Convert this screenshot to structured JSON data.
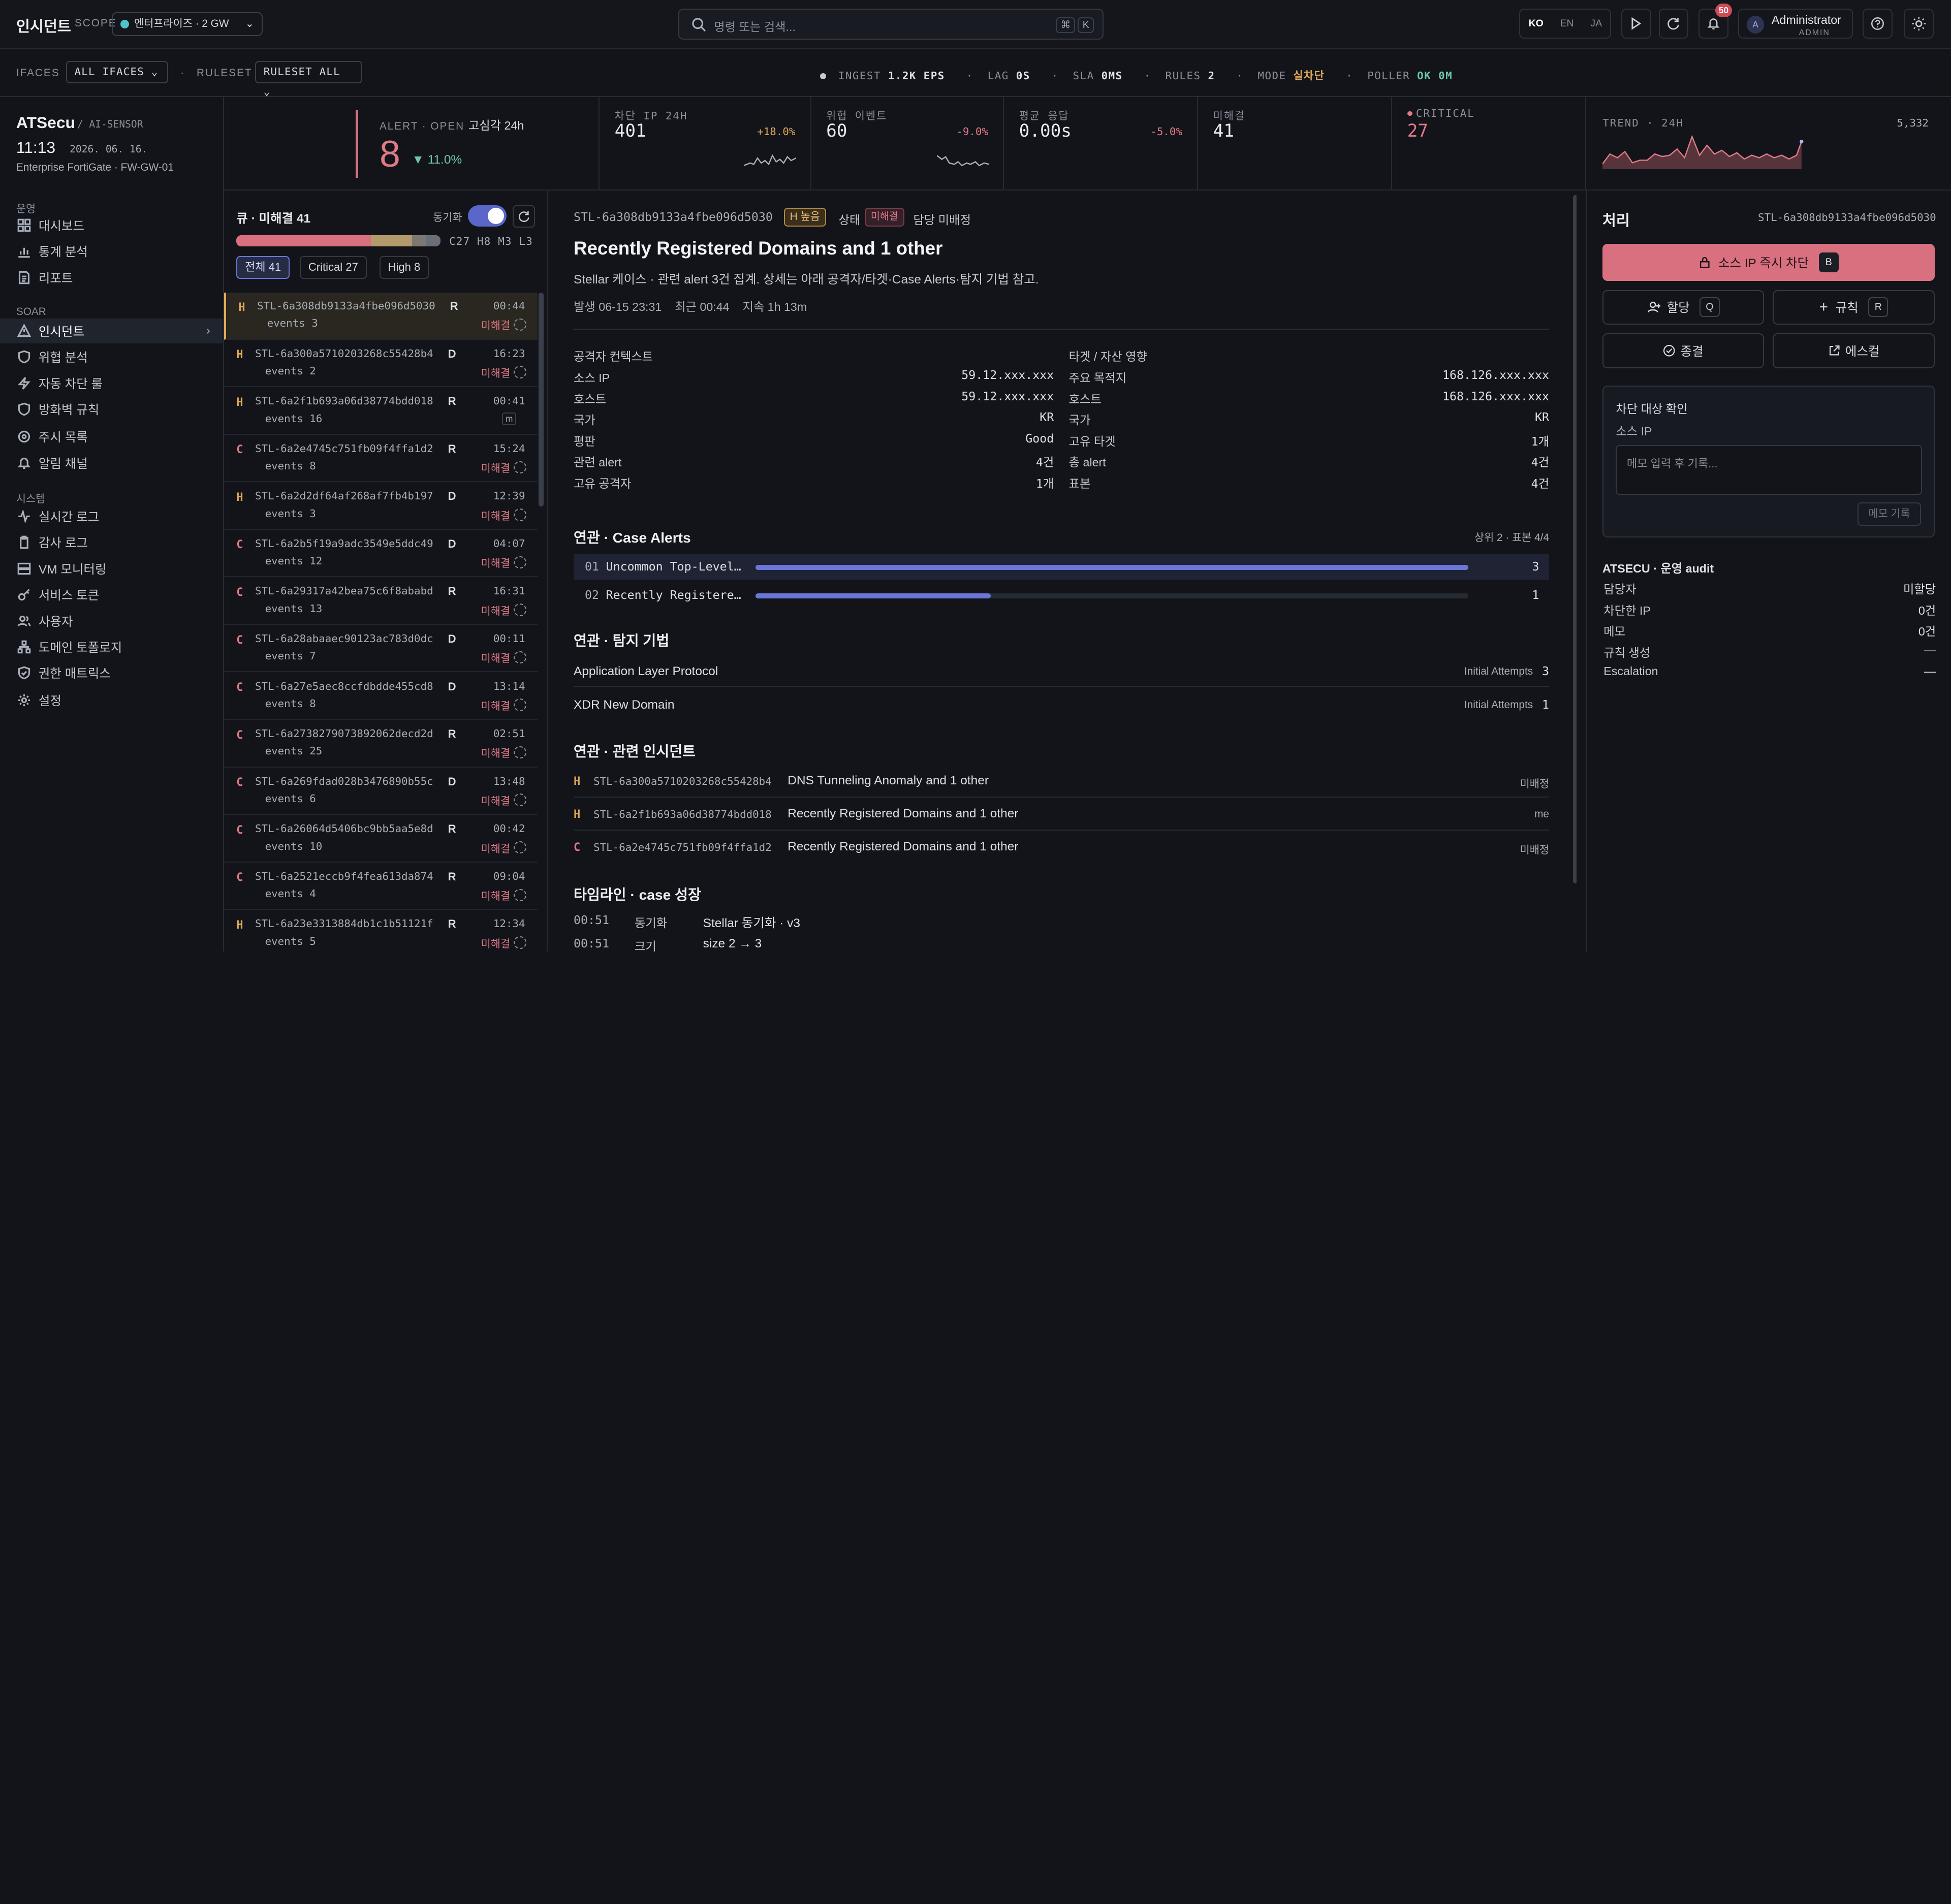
{
  "app": {
    "title": "인시던트",
    "scope_label": "SCOPE",
    "scope_value": "엔터프라이즈 · 2 GW",
    "search_placeholder": "명령 또는 검색...",
    "kbd_cmd": "⌘",
    "kbd_k": "K",
    "langs": [
      "KO",
      "EN",
      "JA"
    ],
    "notif_count": "50",
    "user_name": "Administrator",
    "user_role": "ADMIN",
    "avatar": "A"
  },
  "filters": {
    "ifaces_label": "IFACES",
    "ifaces_value": "ALL IFACES",
    "ruleset_label": "RULESET",
    "ruleset_value": "RULESET ALL",
    "ingest_label": "INGEST",
    "ingest_value": "1.2K EPS",
    "lag_label": "LAG",
    "lag_value": "0S",
    "sla_label": "SLA",
    "sla_value": "0MS",
    "rules_label": "RULES",
    "rules_value": "2",
    "mode_label": "MODE",
    "mode_value": "실차단",
    "poller_label": "POLLER",
    "poller_value": "OK 0M"
  },
  "brand": {
    "name": "ATSecu",
    "sub": "/ AI-SENSOR",
    "time": "11:13",
    "date": "2026. 06. 16.",
    "device": "Enterprise FortiGate · FW-GW-01"
  },
  "stats": {
    "alert_label": "ALERT · OPEN",
    "alert_tag": "고심각 24h",
    "alert_value": "8",
    "alert_delta": "▼ 11.0%",
    "blocked_label": "차단 IP 24H",
    "blocked_value": "401",
    "blocked_pct": "+18.0%",
    "threat_label": "위협 이벤트",
    "threat_value": "60",
    "threat_pct": "-9.0%",
    "resp_label": "평균 응답",
    "resp_value": "0.00s",
    "resp_pct": "-5.0%",
    "unres_label": "미해결",
    "unres_value": "41",
    "crit_label": "CRITICAL",
    "crit_value": "27",
    "trend_label": "TREND · 24H",
    "trend_value": "5,332"
  },
  "nav": {
    "sec_ops": "운영",
    "sec_soar": "SOAR",
    "sec_sys": "시스템",
    "ops": [
      "대시보드",
      "통계 분석",
      "리포트"
    ],
    "soar": [
      "인시던트",
      "위협 분석",
      "자동 차단 룰",
      "방화벽 규칙",
      "주시 목록",
      "알림 채널"
    ],
    "sys": [
      "실시간 로그",
      "감사 로그",
      "VM 모니터링",
      "서비스 토큰",
      "사용자",
      "도메인 토폴로지",
      "권한 매트릭스",
      "설정"
    ]
  },
  "queue": {
    "title": "큐 · 미해결 41",
    "sync_label": "동기화",
    "counts": "C27 H8 M3 L3",
    "tabs": [
      "전체 41",
      "Critical 27",
      "High 8"
    ],
    "rows": [
      {
        "sev": "H",
        "id": "STL-6a308db9133a4fbe096d5030",
        "t": "R",
        "ev": "events 3",
        "time": "00:44",
        "status": "미해결"
      },
      {
        "sev": "H",
        "id": "STL-6a300a5710203268c55428b4",
        "t": "D",
        "ev": "events 2",
        "time": "16:23",
        "status": "미해결"
      },
      {
        "sev": "H",
        "id": "STL-6a2f1b693a06d38774bdd018",
        "t": "R",
        "ev": "events 16",
        "time": "00:41",
        "status": "m"
      },
      {
        "sev": "C",
        "id": "STL-6a2e4745c751fb09f4ffa1d2",
        "t": "R",
        "ev": "events 8",
        "time": "15:24",
        "status": "미해결"
      },
      {
        "sev": "H",
        "id": "STL-6a2d2df64af268af7fb4b197",
        "t": "D",
        "ev": "events 3",
        "time": "12:39",
        "status": "미해결"
      },
      {
        "sev": "C",
        "id": "STL-6a2b5f19a9adc3549e5ddc49",
        "t": "D",
        "ev": "events 12",
        "time": "04:07",
        "status": "미해결"
      },
      {
        "sev": "C",
        "id": "STL-6a29317a42bea75c6f8ababd",
        "t": "R",
        "ev": "events 13",
        "time": "16:31",
        "status": "미해결"
      },
      {
        "sev": "C",
        "id": "STL-6a28abaaec90123ac783d0dc",
        "t": "D",
        "ev": "events 7",
        "time": "00:11",
        "status": "미해결"
      },
      {
        "sev": "C",
        "id": "STL-6a27e5aec8ccfdbdde455cd8",
        "t": "D",
        "ev": "events 8",
        "time": "13:14",
        "status": "미해결"
      },
      {
        "sev": "C",
        "id": "STL-6a2738279073892062decd2d",
        "t": "R",
        "ev": "events 25",
        "time": "02:51",
        "status": "미해결"
      },
      {
        "sev": "C",
        "id": "STL-6a269fdad028b3476890b55c",
        "t": "D",
        "ev": "events 6",
        "time": "13:48",
        "status": "미해결"
      },
      {
        "sev": "C",
        "id": "STL-6a26064d5406bc9bb5aa5e8d",
        "t": "R",
        "ev": "events 10",
        "time": "00:42",
        "status": "미해결"
      },
      {
        "sev": "C",
        "id": "STL-6a2521eccb9f4fea613da874",
        "t": "R",
        "ev": "events 4",
        "time": "09:04",
        "status": "미해결"
      },
      {
        "sev": "H",
        "id": "STL-6a23e3313884db1c1b51121f",
        "t": "R",
        "ev": "events 5",
        "time": "12:34",
        "status": "미해결"
      }
    ]
  },
  "detail": {
    "id": "STL-6a308db9133a4fbe096d5030",
    "sev_badge": "H 높음",
    "state_label": "상태",
    "state_badge": "미해결",
    "owner": "담당 미배정",
    "title": "Recently Registered Domains and 1 other",
    "desc": "Stellar 케이스 · 관련 alert 3건 집계. 상세는 아래 공격자/타겟·Case Alerts·탐지 기법 참고.",
    "start": "발생 06-15 23:31",
    "latest": "최근 00:44",
    "duration": "지속 1h 13m",
    "attacker_title": "공격자 컨텍스트",
    "target_title": "타겟 / 자산 영향",
    "attacker": [
      [
        "소스 IP",
        "59.12.xxx.xxx"
      ],
      [
        "호스트",
        "59.12.xxx.xxx"
      ],
      [
        "국가",
        "KR"
      ],
      [
        "평판",
        "Good"
      ],
      [
        "관련 alert",
        "4건"
      ],
      [
        "고유 공격자",
        "1개"
      ]
    ],
    "target": [
      [
        "주요 목적지",
        "168.126.xxx.xxx"
      ],
      [
        "호스트",
        "168.126.xxx.xxx"
      ],
      [
        "국가",
        "KR"
      ],
      [
        "고유 타겟",
        "1개"
      ],
      [
        "총 alert",
        "4건"
      ],
      [
        "표본",
        "4건"
      ]
    ],
    "alerts_title": "연관 · Case Alerts",
    "alerts_meta": "상위 2 · 표본 4/4",
    "alerts": [
      {
        "n": "01",
        "name": "Uncommon Top-Level…",
        "count": "3",
        "frac": 1.0
      },
      {
        "n": "02",
        "name": "Recently Registere…",
        "count": "1",
        "frac": 0.33
      }
    ],
    "tech_title": "연관 · 탐지 기법",
    "techs": [
      {
        "name": "Application Layer Protocol",
        "tag": "Initial Attempts",
        "count": "3"
      },
      {
        "name": "XDR New Domain",
        "tag": "Initial Attempts",
        "count": "1"
      }
    ],
    "related_title": "연관 · 관련 인시던트",
    "related": [
      {
        "sev": "H",
        "id": "STL-6a300a5710203268c55428b4",
        "title": "DNS Tunneling Anomaly and 1 other",
        "owner": "미배정"
      },
      {
        "sev": "H",
        "id": "STL-6a2f1b693a06d38774bdd018",
        "title": "Recently Registered Domains and 1 other",
        "owner": "me"
      },
      {
        "sev": "C",
        "id": "STL-6a2e4745c751fb09f4ffa1d2",
        "title": "Recently Registered Domains and 1 other",
        "owner": "미배정"
      }
    ],
    "timeline_title": "타임라인 · case 성장",
    "timeline": [
      {
        "time": "00:51",
        "kind": "동기화",
        "text": "Stellar 동기화 · v3"
      },
      {
        "time": "00:51",
        "kind": "크기",
        "text": "size 2 → 3"
      }
    ]
  },
  "panel": {
    "title": "처리",
    "id": "STL-6a308db9133a4fbe096d5030",
    "block_label": "소스 IP 즉시 차단",
    "block_key": "B",
    "assign_label": "할당",
    "assign_key": "Q",
    "rule_label": "규칙",
    "rule_key": "R",
    "close_label": "종결",
    "esc_label": "에스컬",
    "confirm_title": "차단 대상 확인",
    "confirm_sub": "소스 IP",
    "memo_placeholder": "메모 입력 후 기록...",
    "memo_btn": "메모 기록",
    "audit_title": "ATSECU · 운영 audit",
    "audit": [
      [
        "담당자",
        "미할당"
      ],
      [
        "차단한 IP",
        "0건"
      ],
      [
        "메모",
        "0건"
      ],
      [
        "규칙 생성",
        "—"
      ],
      [
        "Escalation",
        "—"
      ]
    ]
  },
  "colors": {
    "high": "#e0a85a",
    "critical": "#e07a86",
    "accent": "#6b76d8",
    "block": "#d9707f"
  }
}
